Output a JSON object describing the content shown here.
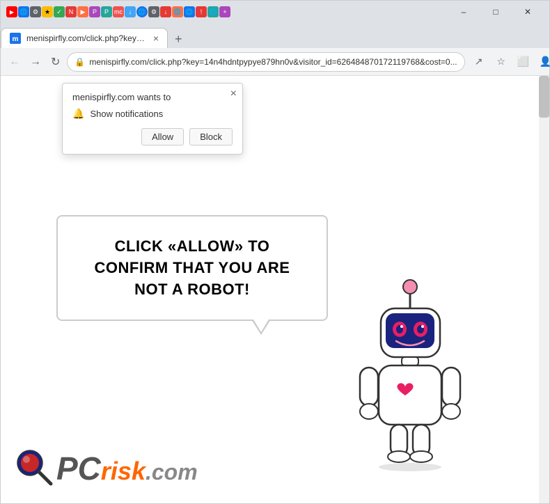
{
  "browser": {
    "title": "menispirfly.com/click.php?key=14n4hdntpypye879hn0v&visitor_id=626484870172119768&cost=0...",
    "url": "menispirfly.com/click.php?key=14n4hdntpypye879hn0v&visitor_id=626484870172119768&cost=0...",
    "tab_title": "menispirfly.com/click.php?key=14n4h..."
  },
  "popup": {
    "title": "menispirfly.com wants to",
    "notification_label": "Show notifications",
    "allow_label": "Allow",
    "block_label": "Block",
    "close_label": "×"
  },
  "page": {
    "bubble_text": "CLICK «ALLOW» TO CONFIRM THAT YOU ARE NOT A ROBOT!"
  },
  "logo": {
    "pc_text": "PC",
    "risk_text": "risk",
    "com_text": ".com"
  },
  "window_controls": {
    "minimize": "–",
    "maximize": "□",
    "close": "✕"
  }
}
